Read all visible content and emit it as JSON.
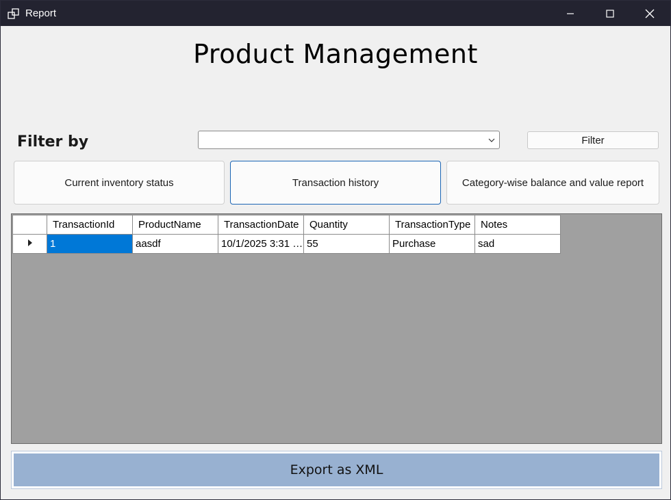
{
  "window": {
    "title": "Report",
    "icons": {
      "app": "app-window-icon",
      "minimize": "minimize-icon",
      "maximize": "maximize-icon",
      "close": "close-icon"
    }
  },
  "main": {
    "heading": "Product Management",
    "filter_label": "Filter by",
    "filter_combo_value": "",
    "filter_button": "Filter",
    "report_tabs": [
      {
        "label": "Current inventory status",
        "active": false
      },
      {
        "label": "Transaction history",
        "active": true
      },
      {
        "label": "Category-wise balance and value report",
        "active": false
      }
    ]
  },
  "grid": {
    "columns": [
      "TransactionId",
      "ProductName",
      "TransactionDate",
      "Quantity",
      "TransactionType",
      "Notes"
    ],
    "rows": [
      [
        "1",
        "aasdf",
        "10/1/2025 3:31 …",
        "55",
        "Purchase",
        "sad"
      ]
    ],
    "selected_cell_color": "#0078d7",
    "empty_area_color": "#a0a0a0"
  },
  "footer": {
    "export_button": "Export as XML",
    "export_button_color": "#98b1d1"
  }
}
